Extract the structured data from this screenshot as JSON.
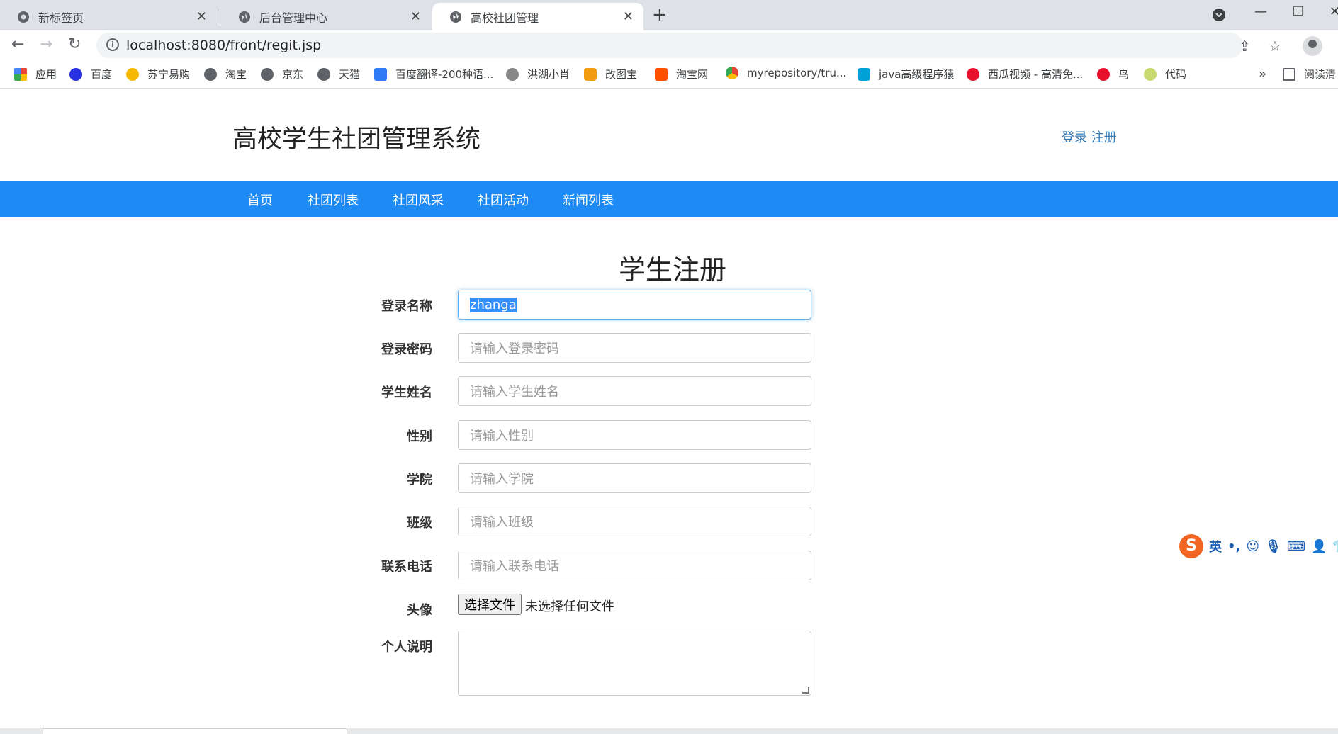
{
  "browser": {
    "tabs": [
      {
        "title": "新标签页",
        "active": false
      },
      {
        "title": "后台管理中心",
        "active": false
      },
      {
        "title": "高校社团管理",
        "active": true
      }
    ],
    "url": "localhost:8080/front/regit.jsp",
    "bookmarks": [
      {
        "label": "应用",
        "icon": "apps-grid-icon",
        "color": "#4285f4"
      },
      {
        "label": "百度",
        "icon": "baidu-paw-icon",
        "color": "#2932e1"
      },
      {
        "label": "苏宁易购",
        "icon": "suning-icon",
        "color": "#f5b800"
      },
      {
        "label": "淘宝",
        "icon": "globe-icon",
        "color": "#5f6368"
      },
      {
        "label": "京东",
        "icon": "globe-icon",
        "color": "#5f6368"
      },
      {
        "label": "天猫",
        "icon": "globe-icon",
        "color": "#5f6368"
      },
      {
        "label": "百度翻译-200种语...",
        "icon": "translate-icon",
        "color": "#2f7bf6"
      },
      {
        "label": "洪湖小肖",
        "icon": "bird-icon",
        "color": "#888888"
      },
      {
        "label": "改图宝",
        "icon": "gaitubao-icon",
        "color": "#f39c12"
      },
      {
        "label": "淘宝网",
        "icon": "taobao-icon",
        "color": "#ff5000"
      },
      {
        "label": "myrepository/tru...",
        "icon": "chrome-icon",
        "color": "#34a853"
      },
      {
        "label": "java高级程序猿",
        "icon": "bilibili-icon",
        "color": "#00a1d6"
      },
      {
        "label": "西瓜视频 - 高清免...",
        "icon": "xigua-icon",
        "color": "#e8112d"
      },
      {
        "label": "鸟",
        "icon": "bird-red-icon",
        "color": "#e8112d"
      },
      {
        "label": "代码",
        "icon": "leaf-icon",
        "color": "#c8d96f"
      }
    ],
    "bookmarks_overflow": "»",
    "reading_list": "阅读清"
  },
  "site": {
    "title": "高校学生社团管理系统",
    "login": "登录",
    "register": "注册",
    "nav": [
      "首页",
      "社团列表",
      "社团风采",
      "社团活动",
      "新闻列表"
    ]
  },
  "form": {
    "title": "学生注册",
    "fields": [
      {
        "label": "登录名称",
        "value": "zhanga",
        "placeholder": ""
      },
      {
        "label": "登录密码",
        "value": "",
        "placeholder": "请输入登录密码"
      },
      {
        "label": "学生姓名",
        "value": "",
        "placeholder": "请输入学生姓名"
      },
      {
        "label": "性别",
        "value": "",
        "placeholder": "请输入性别"
      },
      {
        "label": "学院",
        "value": "",
        "placeholder": "请输入学院"
      },
      {
        "label": "班级",
        "value": "",
        "placeholder": "请输入班级"
      },
      {
        "label": "联系电话",
        "value": "",
        "placeholder": "请输入联系电话"
      }
    ],
    "avatar_label": "头像",
    "file_button": "选择文件",
    "file_status": "未选择任何文件",
    "bio_label": "个人说明"
  },
  "ime": {
    "logo": "S",
    "mode": "英",
    "punct": "•,"
  },
  "colors": {
    "nav_bg": "#1e8bf5",
    "link": "#337ab7",
    "focus": "#66afe9",
    "selection": "#3390ff"
  }
}
